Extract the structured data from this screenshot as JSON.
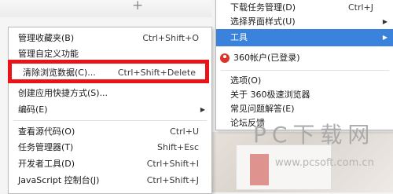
{
  "tabbar": {
    "new_tab_icon": "plus-icon",
    "new_tab_glyph": "+"
  },
  "right_menu": {
    "items": [
      {
        "label": "下载任务管理(D)",
        "shortcut": "Ctrl+J"
      },
      {
        "label": "选择界面样式(U)",
        "submenu": true
      },
      {
        "label": "工具",
        "submenu": true,
        "highlighted": true
      },
      {
        "label": "360帐户(已登录)",
        "icon": "user-account-icon"
      },
      {
        "label": "选项(O)"
      },
      {
        "label": "关于 360极速浏览器"
      },
      {
        "label": "常见问题解答(E)"
      },
      {
        "label": "论坛反馈"
      }
    ]
  },
  "left_menu": {
    "items": [
      {
        "label": "管理收藏夹(B)",
        "shortcut": "Ctrl+Shift+O"
      },
      {
        "label": "管理自定义功能"
      },
      {
        "label": "清除浏览数据(C)...",
        "shortcut": "Ctrl+Shift+Delete"
      },
      {
        "label": "创建应用快捷方式(S)..."
      },
      {
        "label": "编码(E)",
        "submenu": true
      },
      {
        "label": "查看源代码(O)",
        "shortcut": "Ctrl+U"
      },
      {
        "label": "任务管理器(T)",
        "shortcut": "Shift+Esc"
      },
      {
        "label": "开发者工具(D)",
        "shortcut": "Ctrl+Shift+I"
      },
      {
        "label": "JavaScript 控制台(J)",
        "shortcut": "Ctrl+Shift+J"
      }
    ]
  },
  "submenu_arrow_glyph": "▶",
  "annotation": {
    "color": "#e8141a"
  },
  "accent_color": "#3b82dd",
  "watermark": {
    "text": "PC下载网",
    "url": "www.pcsoft.com.cn"
  }
}
